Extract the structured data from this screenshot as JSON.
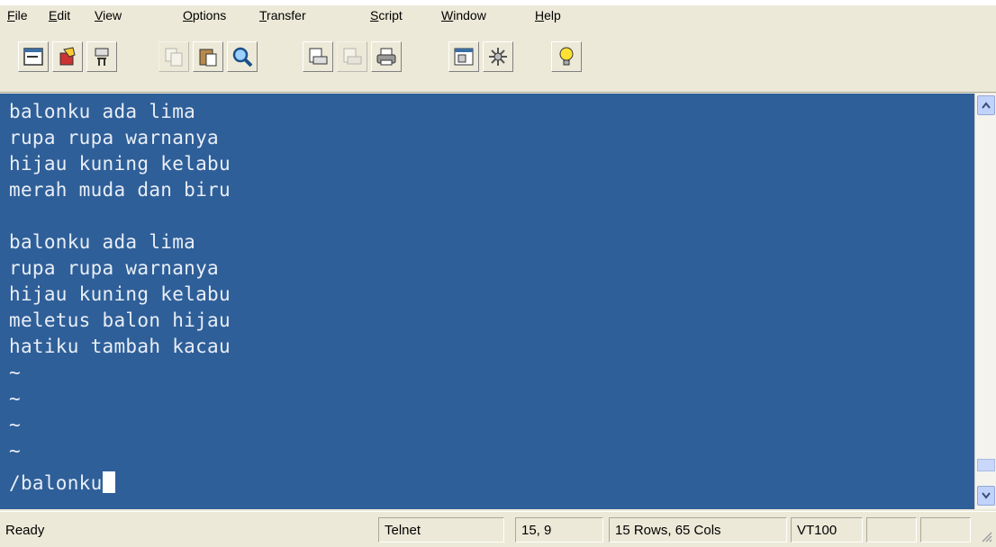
{
  "menu": {
    "items": [
      "File",
      "Edit",
      "View",
      "Options",
      "Transfer",
      "Script",
      "Window",
      "Help"
    ]
  },
  "toolbar": {
    "buttons": [
      {
        "icon": "connect-icon"
      },
      {
        "icon": "quick-connect-icon"
      },
      {
        "icon": "disconnect-icon"
      },
      {
        "icon": "copy-icon"
      },
      {
        "icon": "paste-icon"
      },
      {
        "icon": "find-icon"
      },
      {
        "icon": "print-setup-icon"
      },
      {
        "icon": "print-selection-icon"
      },
      {
        "icon": "print-icon"
      },
      {
        "icon": "session-options-icon"
      },
      {
        "icon": "keymap-icon"
      },
      {
        "icon": "help-icon"
      }
    ]
  },
  "terminal": {
    "lines": [
      "balonku ada lima",
      "rupa rupa warnanya",
      "hijau kuning kelabu",
      "merah muda dan biru",
      "",
      "balonku ada lima",
      "rupa rupa warnanya",
      "hijau kuning kelabu",
      "meletus balon hijau",
      "hatiku tambah kacau",
      "~",
      "~",
      "~",
      "~"
    ],
    "command": "/balonku"
  },
  "status": {
    "ready": "Ready",
    "protocol": "Telnet",
    "position": "15,  9",
    "size": "15 Rows,  65 Cols",
    "emulation": "VT100"
  },
  "colors": {
    "terminal_bg": "#2f5f98",
    "terminal_fg": "#e8eef7",
    "chrome": "#ece9d8"
  }
}
